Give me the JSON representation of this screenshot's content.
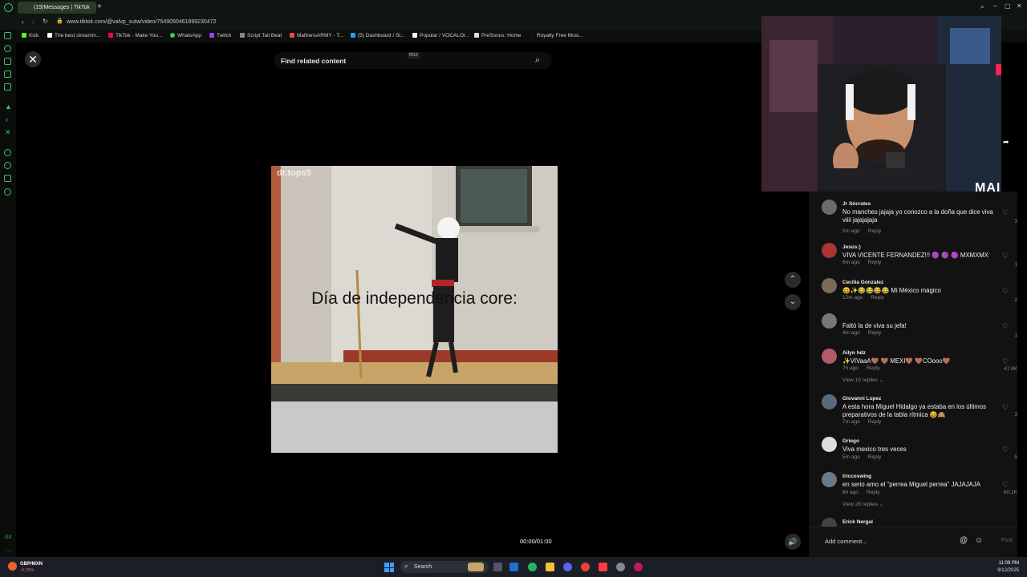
{
  "browser": {
    "tab_title": "(19)Messages | TikTok",
    "url": "www.tiktok.com/@valvp_sutw/video/7549050461899230472",
    "bookmarks": [
      "Kick",
      "The best streamin...",
      "TikTok - Make You...",
      "WhatsApp",
      "Twitch",
      "Script Tail Beat",
      "MalfrensARMY - T...",
      "(5) Dashboard / St...",
      "Popular / VOCALOI...",
      "PreSonus: Home",
      "Royalty Free Musi..."
    ]
  },
  "search": {
    "placeholder": "Find related content",
    "badge": "RGX"
  },
  "video": {
    "watermark": "dr.tops5",
    "caption": "Día de independencia core:",
    "time": "00:00/01:00"
  },
  "webcam": {
    "label": "MAI"
  },
  "comments": [
    {
      "user": "Jr Sócrates",
      "text": "No manches jajaja yo conozco a la doña que dice viva viiii jajajajaja",
      "age": "5m ago",
      "reply": "Reply",
      "likes": "3"
    },
    {
      "user": "Jesús:)",
      "text": "VIVA VICENTE FERNANDEZ!!! 🟣 🟣 🟣 MXMXMX",
      "age": "6m ago",
      "reply": "Reply",
      "likes": "1"
    },
    {
      "user": "Cecilia Gonzalez",
      "text": "😆✨😂😂😂😂 Mi México mágico",
      "age": "12m ago",
      "reply": "Reply",
      "likes": "2"
    },
    {
      "user": "",
      "text": "Faltó la de viva su jefa!",
      "age": "4m ago",
      "reply": "Reply",
      "likes": "1"
    },
    {
      "user": "Ailyn hdz",
      "text": "✨VIVaaA🤎 🤎 MEXI🤎 🤎COooo🤎",
      "age": "7h ago",
      "reply": "Reply",
      "likes": "47.8K",
      "view_replies": "View 15 replies ⌄"
    },
    {
      "user": "Giovanni Lopez",
      "text": "A esta hora Miguel Hidalgo ya estaba en los últimos preparativos de la tabla rítmica 😆🙈",
      "age": "7m ago",
      "reply": "Reply",
      "likes": "3"
    },
    {
      "user": "Griego",
      "text": "Viva mexico tres veces",
      "age": "5m ago",
      "reply": "Reply",
      "likes": "5"
    },
    {
      "user": "triccoswing",
      "text": "en serio amo el \"perrea Miguel perrea\" JAJAJAJA",
      "age": "8h ago",
      "reply": "Reply",
      "likes": "60.1K",
      "view_replies": "View 28 replies ⌄"
    },
    {
      "user": "Erick Nergal",
      "text": "",
      "age": "",
      "reply": "",
      "likes": ""
    }
  ],
  "composer": {
    "placeholder": "Add comment...",
    "post": "Post"
  },
  "taskbar": {
    "stock_name": "GBP/MXN",
    "stock_change": "-0.25%",
    "search": "Search",
    "time": "11:09 PM",
    "date": "9/12/2025"
  },
  "colors": {
    "accent": "#3fbf6f",
    "background": "#000000",
    "panel": "#121212"
  }
}
